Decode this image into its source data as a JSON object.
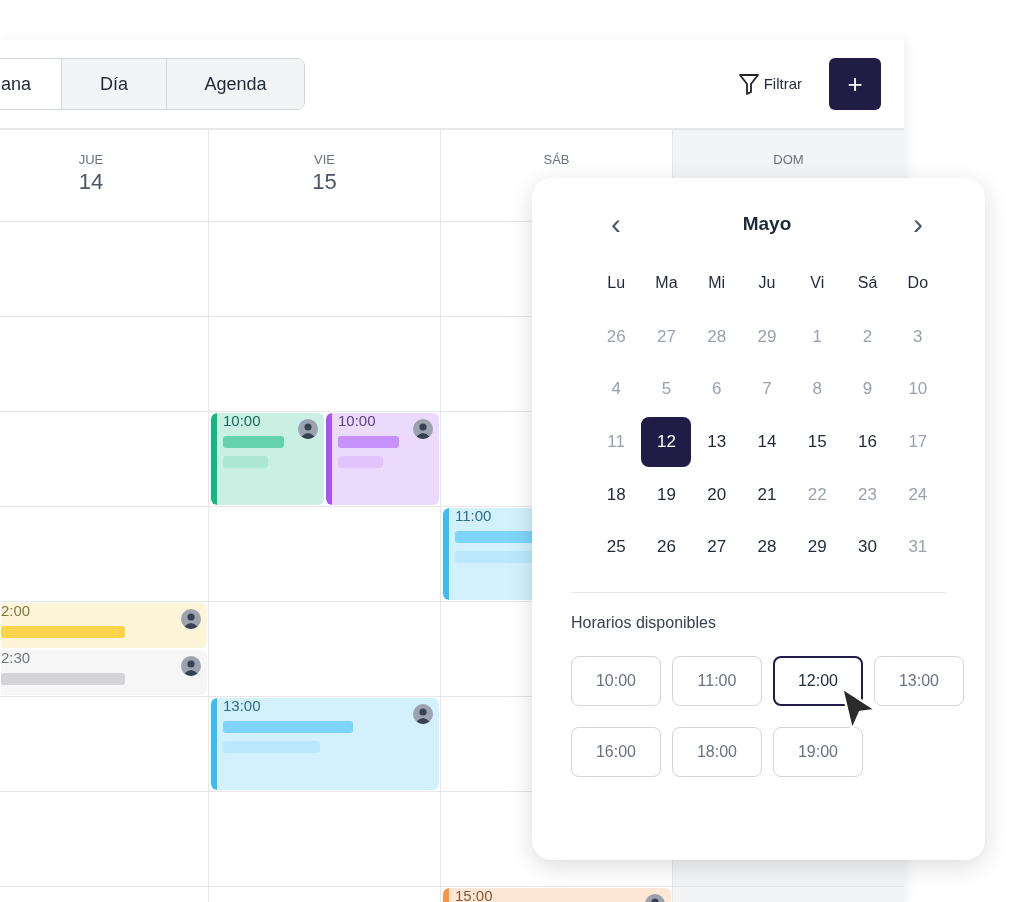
{
  "toolbar": {
    "tabs": [
      {
        "label": "ana",
        "selected": true
      },
      {
        "label": "Día",
        "selected": false
      },
      {
        "label": "Agenda",
        "selected": false
      }
    ],
    "filter_label": "Filtrar",
    "add_label": "+"
  },
  "calendar": {
    "days": [
      {
        "weekday": "JUE",
        "date": "14",
        "selected": false
      },
      {
        "weekday": "VIE",
        "date": "15",
        "selected": false
      },
      {
        "weekday": "SÁB",
        "selected": false
      },
      {
        "weekday": "DOM",
        "selected": true
      }
    ],
    "hour_rows": [
      {
        "cells": [
          {
            "kind": "empty"
          },
          {
            "kind": "empty"
          },
          {
            "kind": "empty"
          },
          {
            "kind": "empty"
          }
        ]
      },
      {
        "cells": [
          {
            "kind": "empty"
          },
          {
            "kind": "empty"
          },
          {
            "kind": "empty"
          },
          {
            "kind": "empty"
          }
        ]
      },
      {
        "cells": [
          {
            "kind": "empty"
          },
          {
            "kind": "events",
            "events": [
              {
                "time": "10:00",
                "color": "#10b981",
                "kind": "full",
                "avatar": true
              },
              {
                "time": "10:00",
                "color": "#a855f7",
                "kind": "full",
                "avatar": true
              }
            ]
          },
          {
            "kind": "empty"
          },
          {
            "kind": "empty"
          }
        ]
      },
      {
        "cells": [
          {
            "kind": "empty"
          },
          {
            "kind": "empty"
          },
          {
            "kind": "events",
            "events": [
              {
                "time": "11:00",
                "color": "#38bdf8",
                "kind": "full"
              }
            ]
          },
          {
            "kind": "empty"
          }
        ]
      },
      {
        "cells": [
          {
            "kind": "events",
            "events": [
              {
                "time": "2:00",
                "color": "#fcd34d",
                "kind": "half",
                "avatar": true
              },
              {
                "time": "2:30",
                "color": "#d4d4d8",
                "kind": "half",
                "avatar": true
              }
            ]
          },
          {
            "kind": "empty"
          },
          {
            "kind": "empty"
          },
          {
            "kind": "empty"
          }
        ]
      },
      {
        "cells": [
          {
            "kind": "empty"
          },
          {
            "kind": "events",
            "events": [
              {
                "time": "13:00",
                "color": "#38bdf8",
                "kind": "full",
                "avatar": true
              }
            ]
          },
          {
            "kind": "empty"
          },
          {
            "kind": "empty"
          }
        ]
      },
      {
        "cells": [
          {
            "kind": "empty"
          },
          {
            "kind": "empty"
          },
          {
            "kind": "empty"
          },
          {
            "kind": "empty"
          }
        ]
      },
      {
        "cells": [
          {
            "kind": "empty"
          },
          {
            "kind": "empty"
          },
          {
            "kind": "events",
            "events": [
              {
                "time": "15:00",
                "color": "#fb923c",
                "kind": "full",
                "avatar": true
              }
            ]
          },
          {
            "kind": "empty"
          }
        ]
      }
    ]
  },
  "date_picker": {
    "prev": "‹",
    "month": "Mayo",
    "next": "›",
    "weekdays": [
      "Lu",
      "Ma",
      "Mi",
      "Ju",
      "Vi",
      "Sá",
      "Do"
    ],
    "dates": [
      {
        "label": "26",
        "muted": true,
        "selected": false
      },
      {
        "label": "27",
        "muted": true,
        "selected": false
      },
      {
        "label": "28",
        "muted": true,
        "selected": false
      },
      {
        "label": "29",
        "muted": true,
        "selected": false
      },
      {
        "label": "1",
        "muted": true,
        "selected": false
      },
      {
        "label": "2",
        "muted": true,
        "selected": false
      },
      {
        "label": "3",
        "muted": true,
        "selected": false
      },
      {
        "label": "4",
        "muted": true,
        "selected": false
      },
      {
        "label": "5",
        "muted": true,
        "selected": false
      },
      {
        "label": "6",
        "muted": true,
        "selected": false
      },
      {
        "label": "7",
        "muted": true,
        "selected": false
      },
      {
        "label": "8",
        "muted": true,
        "selected": false
      },
      {
        "label": "9",
        "muted": true,
        "selected": false
      },
      {
        "label": "10",
        "muted": true,
        "selected": false
      },
      {
        "label": "11",
        "muted": true,
        "selected": false
      },
      {
        "label": "12",
        "muted": false,
        "selected": true
      },
      {
        "label": "13",
        "muted": false,
        "selected": false
      },
      {
        "label": "14",
        "muted": false,
        "selected": false
      },
      {
        "label": "15",
        "muted": false,
        "selected": false
      },
      {
        "label": "16",
        "muted": false,
        "selected": false
      },
      {
        "label": "17",
        "muted": true,
        "selected": false
      },
      {
        "label": "18",
        "muted": false,
        "selected": false
      },
      {
        "label": "19",
        "muted": false,
        "selected": false
      },
      {
        "label": "20",
        "muted": false,
        "selected": false
      },
      {
        "label": "21",
        "muted": false,
        "selected": false
      },
      {
        "label": "22",
        "muted": true,
        "selected": false
      },
      {
        "label": "23",
        "muted": true,
        "selected": false
      },
      {
        "label": "24",
        "muted": true,
        "selected": false
      },
      {
        "label": "25",
        "muted": false,
        "selected": false
      },
      {
        "label": "26",
        "muted": false,
        "selected": false
      },
      {
        "label": "27",
        "muted": false,
        "selected": false
      },
      {
        "label": "28",
        "muted": false,
        "selected": false
      },
      {
        "label": "29",
        "muted": false,
        "selected": false
      },
      {
        "label": "30",
        "muted": false,
        "selected": false
      },
      {
        "label": "31",
        "muted": true,
        "selected": false
      }
    ],
    "slots_title": "Horarios disponibles",
    "slots": [
      {
        "label": "10:00",
        "selected": false
      },
      {
        "label": "11:00",
        "selected": false
      },
      {
        "label": "12:00",
        "selected": true
      },
      {
        "label": "13:00",
        "selected": false
      },
      {
        "label": "16:00",
        "selected": false
      },
      {
        "label": "18:00",
        "selected": false
      },
      {
        "label": "19:00",
        "selected": false
      }
    ]
  }
}
